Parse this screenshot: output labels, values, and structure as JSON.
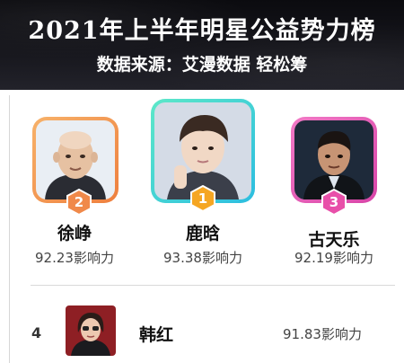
{
  "header": {
    "title": "2021年上半年明星公益势力榜",
    "subtitle": "数据来源：艾漫数据 轻松筹"
  },
  "colors": {
    "header_bg": "#111116",
    "rank2_frame": "#f29a53",
    "rank1_frame": "#3fd6c6",
    "rank3_frame": "#ea57b3",
    "rank2_badge": "#f0894a",
    "rank1_badge": "#f5a623",
    "rank3_badge": "#e84fa9"
  },
  "podium": [
    {
      "rank": "2",
      "name": "徐峥",
      "score": "92.23影响力",
      "avatar_icon": "portrait-bald-man"
    },
    {
      "rank": "1",
      "name": "鹿晗",
      "score": "93.38影响力",
      "avatar_icon": "portrait-young-man"
    },
    {
      "rank": "3",
      "name": "古天乐",
      "score": "92.19影响力",
      "avatar_icon": "portrait-man-suit"
    }
  ],
  "list": [
    {
      "rank": "4",
      "name": "韩红",
      "score": "91.83影响力",
      "avatar_icon": "portrait-woman"
    }
  ]
}
